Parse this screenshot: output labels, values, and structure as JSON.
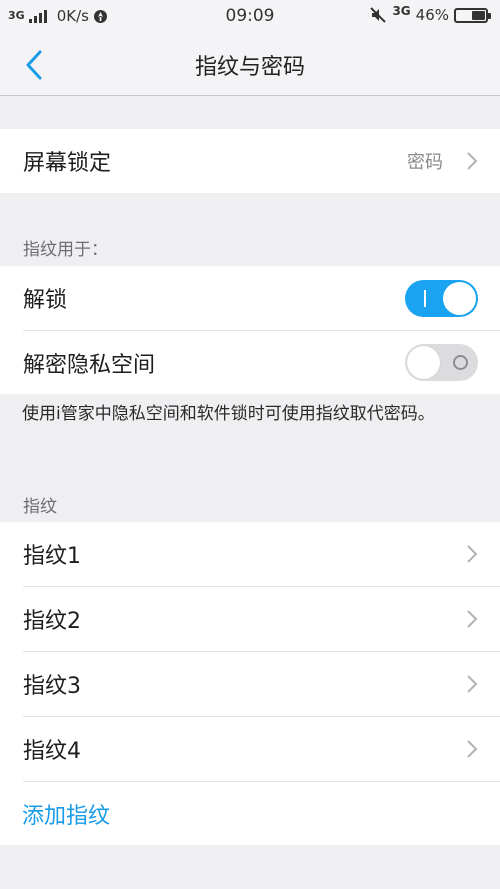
{
  "status_bar": {
    "network": "3G",
    "speed": "0K/s",
    "time": "09:09",
    "network_right": "3G",
    "battery": "46%",
    "battery_level": 0.46
  },
  "header": {
    "title": "指纹与密码",
    "back_icon": "chevron-left-icon",
    "accent_color": "#1a9ce8"
  },
  "screen_lock": {
    "label": "屏幕锁定",
    "value": "密码"
  },
  "fingerprint_usage": {
    "header": "指纹用于：",
    "items": [
      {
        "label": "解锁",
        "enabled": true
      },
      {
        "label": "解密隐私空间",
        "enabled": false
      }
    ],
    "description": "使用i管家中隐私空间和软件锁时可使用指纹取代密码。"
  },
  "fingerprints": {
    "header": "指纹",
    "items": [
      {
        "label": "指纹1"
      },
      {
        "label": "指纹2"
      },
      {
        "label": "指纹3"
      },
      {
        "label": "指纹4"
      }
    ],
    "add_label": "添加指纹"
  }
}
